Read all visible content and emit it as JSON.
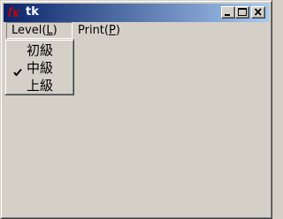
{
  "window": {
    "title": "tk",
    "icon": "tk-feather-icon",
    "controls": {
      "minimize": "minimize-icon",
      "maximize": "maximize-icon",
      "close": "close-icon"
    }
  },
  "menubar": {
    "menus": [
      {
        "label": "Level(L)",
        "mnemonic": "L",
        "open": true
      },
      {
        "label": "Print(P)",
        "mnemonic": "P",
        "open": false
      }
    ]
  },
  "level_menu": {
    "items": [
      {
        "label": "初級",
        "checked": false
      },
      {
        "label": "中級",
        "checked": true
      },
      {
        "label": "上級",
        "checked": false
      }
    ]
  },
  "colors": {
    "titlebar_start": "#0a246a",
    "titlebar_end": "#a6caf0",
    "face": "#d4d0c8",
    "icon_red": "#cc0000"
  }
}
